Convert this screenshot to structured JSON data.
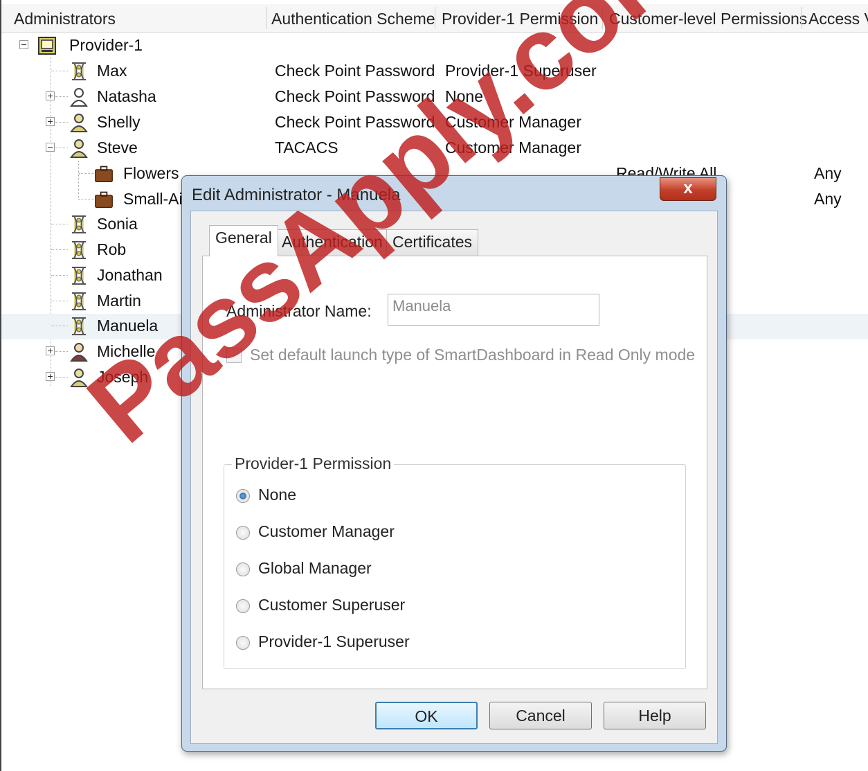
{
  "columns": {
    "administrators": "Administrators",
    "auth_scheme": "Authentication Scheme",
    "provider_permission": "Provider-1 Permission",
    "customer_permissions": "Customer-level Permissions",
    "access": "Access V"
  },
  "tree": {
    "root": "Provider-1",
    "rows": [
      {
        "name": "Max",
        "auth": "Check Point Password",
        "permission": "Provider-1 Superuser"
      },
      {
        "name": "Natasha",
        "auth": "Check Point Password",
        "permission": "None"
      },
      {
        "name": "Shelly",
        "auth": "Check Point Password",
        "permission": "Customer Manager"
      },
      {
        "name": "Steve",
        "auth": "TACACS",
        "permission": "Customer Manager"
      },
      {
        "name": "Flowers",
        "customer_permission": "Read/Write All",
        "access": "Any"
      },
      {
        "name": "Small-Air",
        "access": "Any"
      },
      {
        "name": "Sonia"
      },
      {
        "name": "Rob"
      },
      {
        "name": "Jonathan"
      },
      {
        "name": "Martin"
      },
      {
        "name": "Manuela"
      },
      {
        "name": "Michelle"
      },
      {
        "name": "Joseph"
      }
    ]
  },
  "dialog": {
    "title": "Edit Administrator - Manuela",
    "close_label": "x",
    "tabs": [
      "General",
      "Authentication",
      "Certificates"
    ],
    "admin_name_label": "Administrator Name:",
    "admin_name_value": "Manuela",
    "readonly_checkbox_label": "Set default launch type of SmartDashboard in Read Only mode",
    "permission_group_label": "Provider-1 Permission",
    "permission_options": [
      "None",
      "Customer Manager",
      "Global Manager",
      "Customer Superuser",
      "Provider-1 Superuser"
    ],
    "selected_permission": "None",
    "buttons": {
      "ok": "OK",
      "cancel": "Cancel",
      "help": "Help"
    }
  },
  "watermark": "PassApply.com"
}
